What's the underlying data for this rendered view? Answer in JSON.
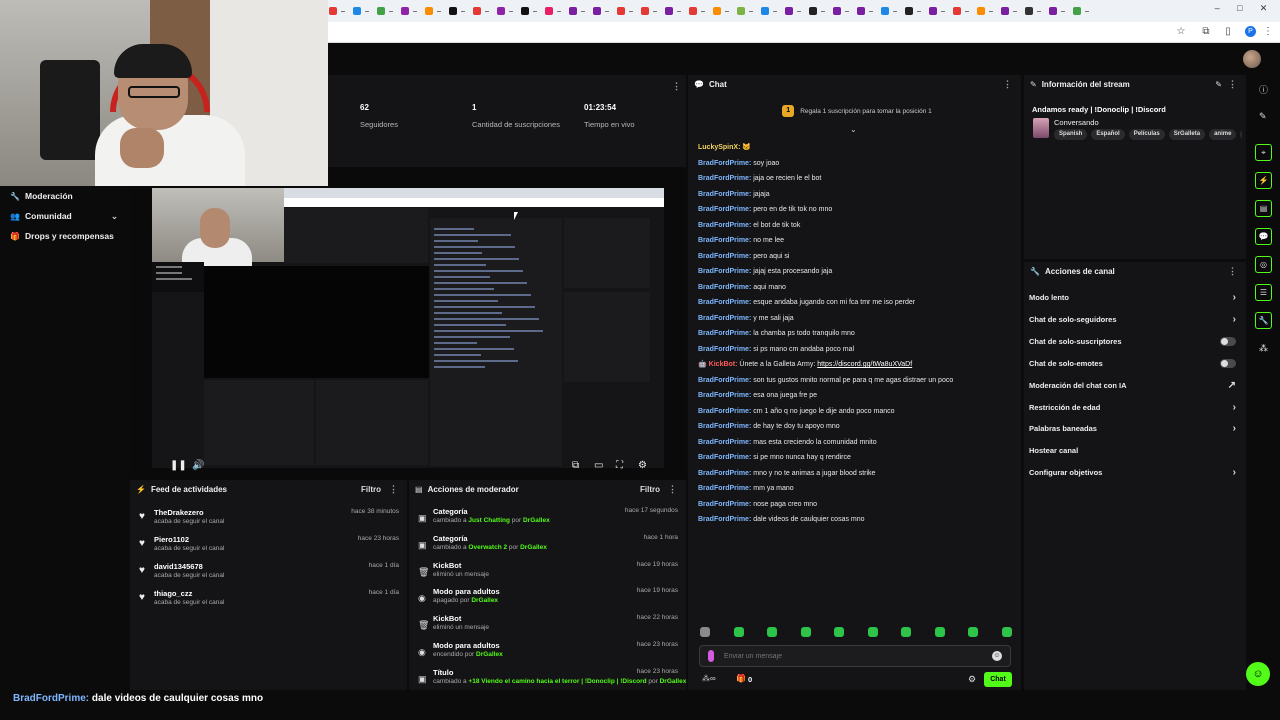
{
  "caption": {
    "user": "BradFordPrime:",
    "text": " dale videos de caulquier cosas mno"
  },
  "sidebar": {
    "items": [
      {
        "label": "Moderación",
        "icon": "wrench-icon"
      },
      {
        "label": "Comunidad",
        "icon": "users-icon"
      },
      {
        "label": "Drops y recompensas",
        "icon": "gift-icon"
      }
    ]
  },
  "stats": [
    {
      "value": "62",
      "label": "Seguidores"
    },
    {
      "value": "1",
      "label": "Cantidad de suscripciones"
    },
    {
      "value": "01:23:54",
      "label": "Tiempo en vivo"
    }
  ],
  "feed": {
    "title": "Feed de actividades",
    "filter": "Filtro",
    "items": [
      {
        "name": "TheDrakezero",
        "sub": "acaba de seguir el canal",
        "time": "hace 38 minutos"
      },
      {
        "name": "Piero1102",
        "sub": "acaba de seguir el canal",
        "time": "hace 23 horas"
      },
      {
        "name": "david1345678",
        "sub": "acaba de seguir el canal",
        "time": "hace 1 día"
      },
      {
        "name": "thiago_czz",
        "sub": "acaba de seguir el canal",
        "time": "hace 1 día"
      }
    ]
  },
  "modactions": {
    "title": "Acciones de moderador",
    "filter": "Filtro",
    "items": [
      {
        "name": "Categoría",
        "pre": "cambiado a ",
        "hl": "Just Chatting",
        "mid": " por ",
        "by": "DrGallex",
        "time": "hace 17 segundos",
        "icon": "category-icon"
      },
      {
        "name": "Categoría",
        "pre": "cambiado a ",
        "hl": "Overwatch 2",
        "mid": " por ",
        "by": "DrGallex",
        "time": "hace 1 hora",
        "icon": "category-icon"
      },
      {
        "name": "KickBot",
        "pre": "eliminó un mensaje",
        "hl": "",
        "mid": "",
        "by": "",
        "time": "hace 19 horas",
        "icon": "trash-icon"
      },
      {
        "name": "Modo para adultos",
        "pre": "apagado por ",
        "hl": "",
        "mid": "",
        "by": "DrGallex",
        "time": "hace 19 horas",
        "icon": "eye-icon"
      },
      {
        "name": "KickBot",
        "pre": "eliminó un mensaje",
        "hl": "",
        "mid": "",
        "by": "",
        "time": "hace 22 horas",
        "icon": "trash-icon"
      },
      {
        "name": "Modo para adultos",
        "pre": "encendido por ",
        "hl": "",
        "mid": "",
        "by": "DrGallex",
        "time": "hace 23 horas",
        "icon": "eye-icon"
      },
      {
        "name": "Título",
        "pre": "cambiado a ",
        "hl": "+18 Viendo el camino hacia el terror | !Donoclip | !Discord",
        "mid": " por ",
        "by": "DrGallex",
        "time": "hace 23 horas",
        "icon": "title-icon"
      }
    ]
  },
  "chat": {
    "title": "Chat",
    "pinned": "Regala 1 suscripción para tomar la posición 1",
    "pinned_rank": "1",
    "messages": [
      {
        "user": "LuckySpinX:",
        "text": "",
        "cls": "gold"
      },
      {
        "user": "BradFordPrime:",
        "text": " soy joao",
        "cls": ""
      },
      {
        "user": "BradFordPrime:",
        "text": " jaja oe recien le el bot",
        "cls": ""
      },
      {
        "user": "BradFordPrime:",
        "text": " jajaja",
        "cls": ""
      },
      {
        "user": "BradFordPrime:",
        "text": " pero en de tik tok no mno",
        "cls": ""
      },
      {
        "user": "BradFordPrime:",
        "text": " el bot de tik tok",
        "cls": ""
      },
      {
        "user": "BradFordPrime:",
        "text": " no me lee",
        "cls": ""
      },
      {
        "user": "BradFordPrime:",
        "text": " pero aqui si",
        "cls": ""
      },
      {
        "user": "BradFordPrime:",
        "text": " jajaj esta procesando jaja",
        "cls": ""
      },
      {
        "user": "BradFordPrime:",
        "text": " aqui mano",
        "cls": ""
      },
      {
        "user": "BradFordPrime:",
        "text": " esque andaba jugando con mi fca tmr me iso perder",
        "cls": ""
      },
      {
        "user": "BradFordPrime:",
        "text": " y me sali jaja",
        "cls": ""
      },
      {
        "user": "BradFordPrime:",
        "text": " la chamba ps todo tranquilo mno",
        "cls": ""
      },
      {
        "user": "BradFordPrime:",
        "text": " si ps mano cm andaba poco mal",
        "cls": ""
      },
      {
        "user": "KickBot:",
        "text": " Únete a la Galleta Army: ",
        "link": "https://discord.gg/tWa8uXVaDf",
        "cls": "red"
      },
      {
        "user": "BradFordPrime:",
        "text": " son tus gustos mnito normal pe para q me agas distraer un poco",
        "cls": ""
      },
      {
        "user": "BradFordPrime:",
        "text": " esa ona juega fre pe",
        "cls": ""
      },
      {
        "user": "BradFordPrime:",
        "text": " cm 1 año q no juego le dije ando poco manco",
        "cls": ""
      },
      {
        "user": "BradFordPrime:",
        "text": " de hay te doy tu apoyo mno",
        "cls": ""
      },
      {
        "user": "BradFordPrime:",
        "text": " mas esta creciendo la comunidad mnito",
        "cls": ""
      },
      {
        "user": "BradFordPrime:",
        "text": " si pe mno nunca hay q rendirce",
        "cls": ""
      },
      {
        "user": "BradFordPrime:",
        "text": " mno y no te animas a jugar blood strike",
        "cls": ""
      },
      {
        "user": "BradFordPrime:",
        "text": " mm ya mano",
        "cls": ""
      },
      {
        "user": "BradFordPrime:",
        "text": " nose paga creo mno",
        "cls": ""
      },
      {
        "user": "BradFordPrime:",
        "text": " dale videos de caulquier cosas mno",
        "cls": ""
      }
    ],
    "input_placeholder": "Enviar un mensaje",
    "count": "0",
    "send_label": "Chat"
  },
  "info": {
    "header": "Información del stream",
    "title": "Andamos ready | !Donoclip | !Discord",
    "category": "Conversando",
    "tags": [
      "Spanish",
      "Español",
      "Películas",
      "SrGalleta",
      "anime",
      "ga"
    ]
  },
  "actions": {
    "header": "Acciones de canal",
    "items": [
      {
        "label": "Modo lento",
        "kind": "chev"
      },
      {
        "label": "Chat de solo-seguidores",
        "kind": "chev"
      },
      {
        "label": "Chat de solo-suscriptores",
        "kind": "toggle"
      },
      {
        "label": "Chat de solo-emotes",
        "kind": "toggle"
      },
      {
        "label": "Moderación del chat con IA",
        "kind": "ext"
      },
      {
        "label": "Restricción de edad",
        "kind": "chev"
      },
      {
        "label": "Palabras baneadas",
        "kind": "chev"
      },
      {
        "label": "Hostear canal",
        "kind": "none"
      },
      {
        "label": "Configurar objetivos",
        "kind": "chev"
      }
    ]
  },
  "colors": {
    "accent": "#53fc18",
    "panel": "#141416",
    "bg": "#0b0b0c",
    "username": "#7eb7ff"
  }
}
